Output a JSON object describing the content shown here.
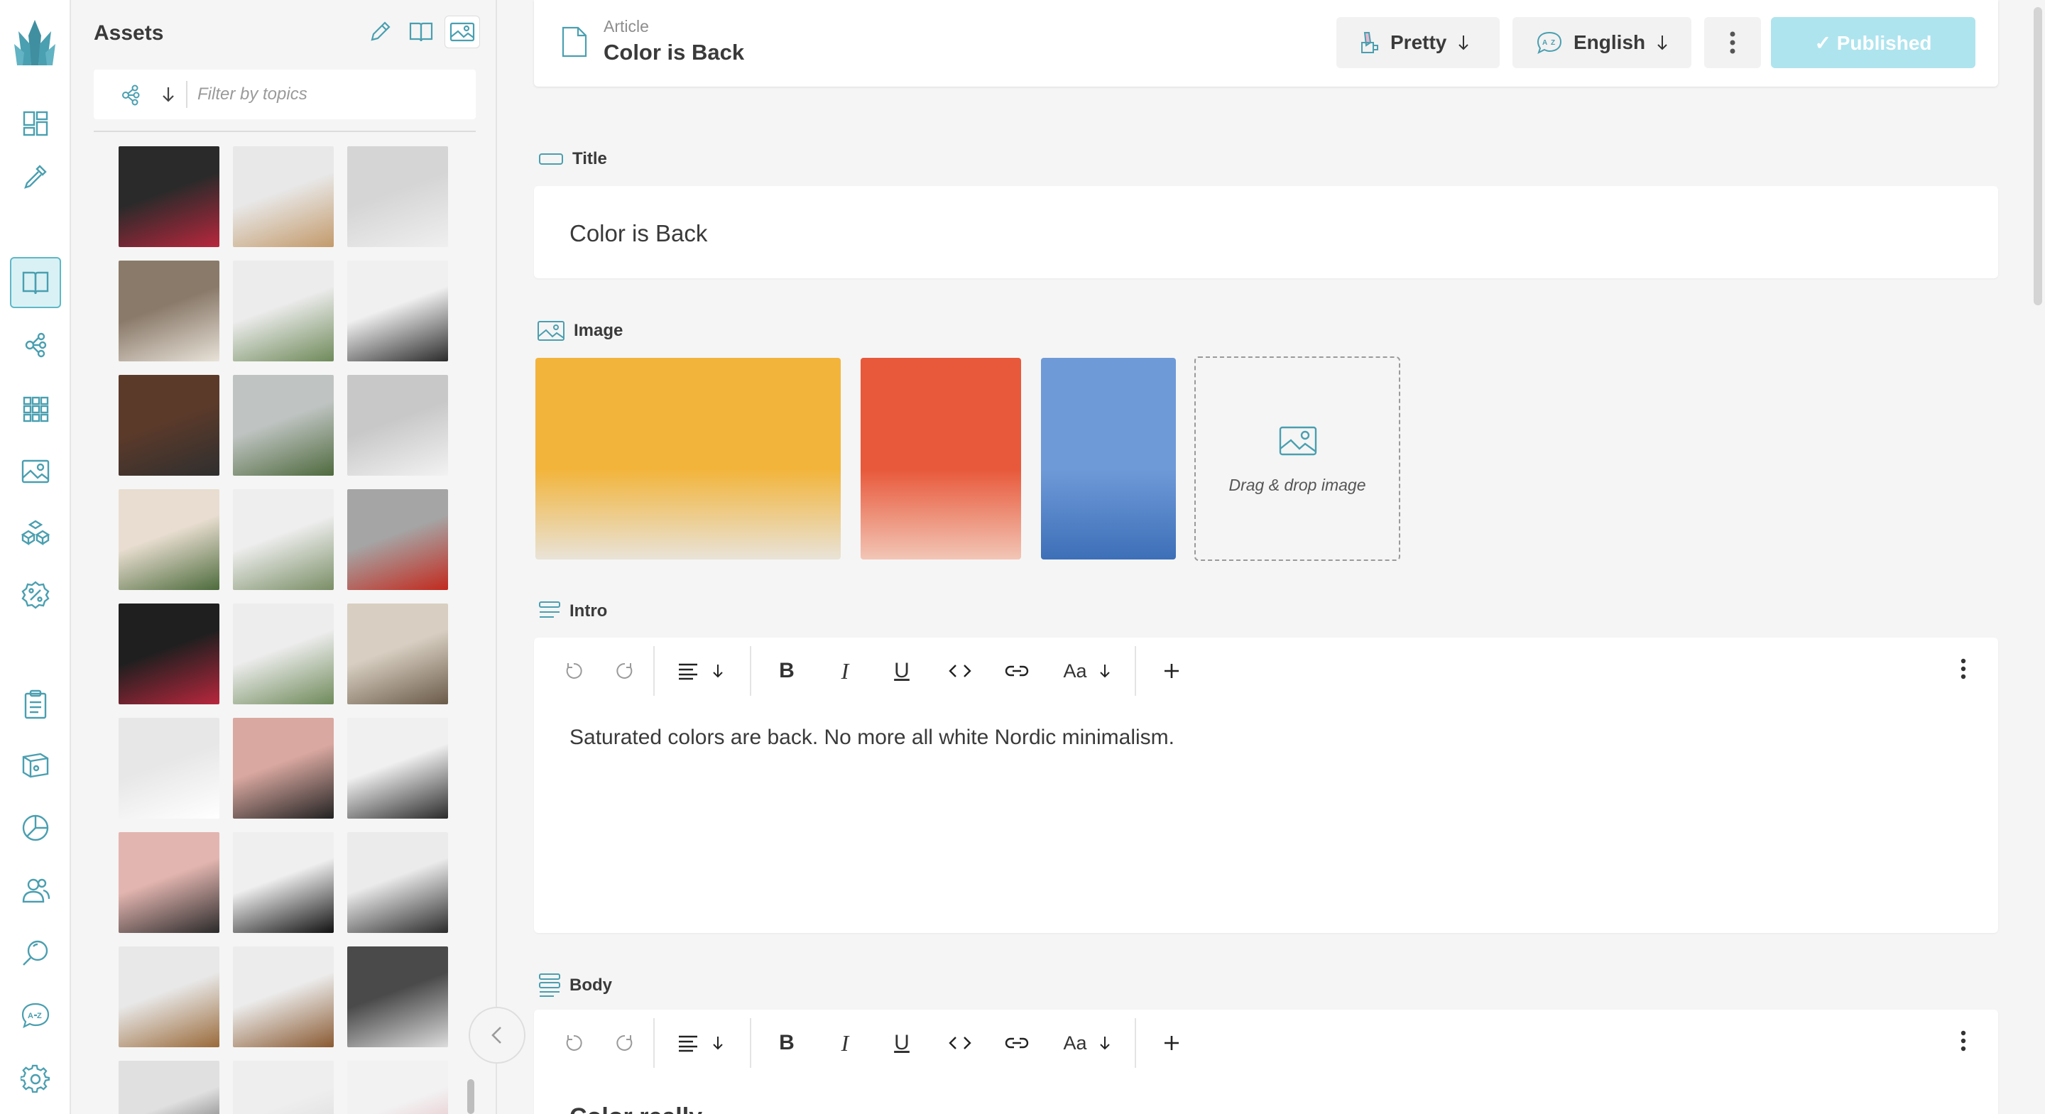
{
  "colors": {
    "accent": "#4a9fb0",
    "accent_light": "#d9f1f5",
    "published_bg": "#aee4ee"
  },
  "rail": {
    "items": [
      "dashboard-icon",
      "pipette-icon",
      "book-icon",
      "topics-icon",
      "grid-icon",
      "image-icon",
      "boxes-icon",
      "percent-icon",
      "clipboard-icon",
      "box-icon",
      "analytics-icon",
      "users-icon",
      "search-icon",
      "translate-icon",
      "gear-icon"
    ]
  },
  "assets": {
    "title": "Assets",
    "filter_placeholder": "Filter by topics",
    "thumbnails": [
      {
        "name": "red-lounge-chair",
        "c1": "#2a2a2a",
        "c2": "#b8273d"
      },
      {
        "name": "white-chair-wood-floor",
        "c1": "#e8e8e8",
        "c2": "#c39a6b"
      },
      {
        "name": "white-shell-chair",
        "c1": "#d5d5d5",
        "c2": "#efefef"
      },
      {
        "name": "vases-shelf",
        "c1": "#8a7a6a",
        "c2": "#e8e2d8"
      },
      {
        "name": "plant-white-chair",
        "c1": "#ececec",
        "c2": "#6f8a5a"
      },
      {
        "name": "black-chair-window",
        "c1": "#f0f0f0",
        "c2": "#2b2b2b"
      },
      {
        "name": "black-armchair",
        "c1": "#5c3a2a",
        "c2": "#2f2f2f"
      },
      {
        "name": "white-chair-plant",
        "c1": "#bfc4c2",
        "c2": "#4f6a3e"
      },
      {
        "name": "white-chair-grey",
        "c1": "#c8c8c8",
        "c2": "#f2f2f2"
      },
      {
        "name": "rattan-chair",
        "c1": "#e8ddd0",
        "c2": "#4d6b3c"
      },
      {
        "name": "plant-chair-light",
        "c1": "#eeeeee",
        "c2": "#7a8e66"
      },
      {
        "name": "red-sofa",
        "c1": "#a5a5a5",
        "c2": "#c22a1e"
      },
      {
        "name": "red-lounge-chair-2",
        "c1": "#1f1f1f",
        "c2": "#b8273d"
      },
      {
        "name": "plant-chair-2",
        "c1": "#ededed",
        "c2": "#6f8a5a"
      },
      {
        "name": "vase-interior",
        "c1": "#d8cfc2",
        "c2": "#6a5a48"
      },
      {
        "name": "bathroom-vanity",
        "c1": "#e7e7e7",
        "c2": "#ffffff"
      },
      {
        "name": "pink-bathroom",
        "c1": "#d9a8a0",
        "c2": "#222222"
      },
      {
        "name": "dining-table",
        "c1": "#f0f0f0",
        "c2": "#2a2a2a"
      },
      {
        "name": "pink-shelf",
        "c1": "#e3b5b0",
        "c2": "#2a2a2a"
      },
      {
        "name": "black-table",
        "c1": "#efefef",
        "c2": "#111111"
      },
      {
        "name": "dining-set",
        "c1": "#ebebeb",
        "c2": "#2b2b2b"
      },
      {
        "name": "wood-side-table",
        "c1": "#e8e8e8",
        "c2": "#9a6a3a"
      },
      {
        "name": "nesting-tables",
        "c1": "#ececec",
        "c2": "#8a5a32"
      },
      {
        "name": "bedroom",
        "c1": "#4a4a4a",
        "c2": "#dcdcdc"
      },
      {
        "name": "dried-flowers",
        "c1": "#e0e0e0",
        "c2": "#3a3a3a"
      },
      {
        "name": "white-shelf",
        "c1": "#eeeeee",
        "c2": "#d5d5d5"
      },
      {
        "name": "art-frame",
        "c1": "#f2f2f2",
        "c2": "#e0a8b0"
      }
    ]
  },
  "header": {
    "doc_type": "Article",
    "doc_title": "Color is Back",
    "style_label": "Pretty",
    "language_label": "English",
    "status_label": "✓ Published"
  },
  "fields": {
    "title_label": "Title",
    "title_value": "Color is Back",
    "image_label": "Image",
    "images": [
      {
        "name": "yellow-cafe-image",
        "c1": "#f2b43a",
        "c2": "#e9e3d8"
      },
      {
        "name": "orange-toilet-paper-image",
        "c1": "#e8583a",
        "c2": "#f2c6b6"
      },
      {
        "name": "blue-tiles-image",
        "c1": "#6f9ad8",
        "c2": "#3d6fb8"
      }
    ],
    "drop_text": "Drag & drop image",
    "intro_label": "Intro",
    "intro_text": "Saturated colors are back. No more all white Nordic minimalism.",
    "body_label": "Body",
    "body_text": "Color really",
    "font_size_label": "Aa"
  }
}
